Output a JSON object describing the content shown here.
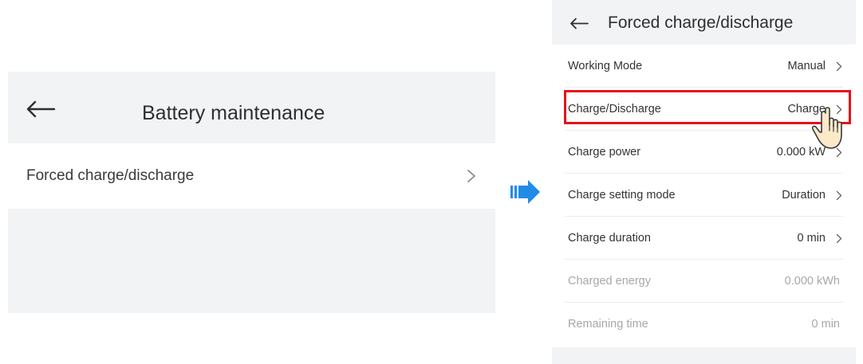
{
  "left_screen": {
    "title": "Battery maintenance",
    "back_icon": "arrow-left-icon",
    "items": [
      {
        "label": "Forced charge/discharge",
        "icon": "chevron-right-icon"
      }
    ]
  },
  "flow_arrow_icon": "arrow-right-icon",
  "right_screen": {
    "title": "Forced charge/discharge",
    "back_icon": "arrow-left-icon",
    "rows": [
      {
        "label": "Working Mode",
        "value": "Manual"
      },
      {
        "label": "Charge/Discharge",
        "value": "Charge"
      },
      {
        "label": "Charge power",
        "value": "0.000 kW"
      },
      {
        "label": "Charge setting mode",
        "value": "Duration"
      },
      {
        "label": "Charge duration",
        "value": "0 min"
      },
      {
        "label": "Charged energy",
        "value": "0.000 kWh"
      },
      {
        "label": "Remaining time",
        "value": "0 min"
      }
    ]
  },
  "highlight_color": "#e3131b",
  "accent_color": "#1f8ce6",
  "cursor_icon": "hand-pointer-icon"
}
